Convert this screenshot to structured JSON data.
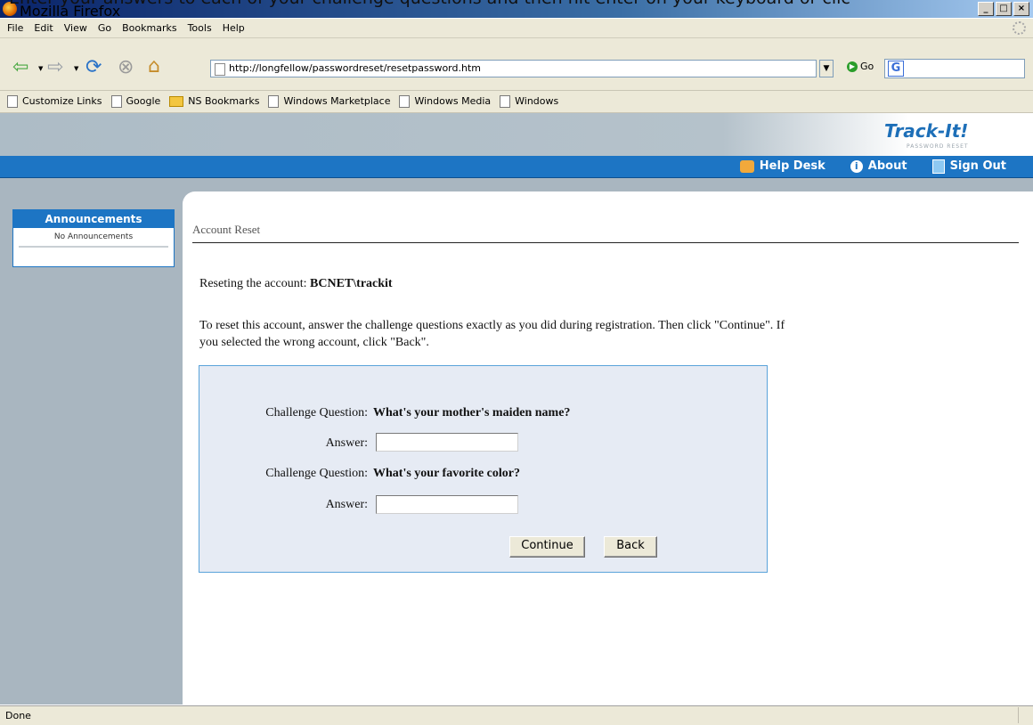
{
  "overlay_caption": "Enter your answers to each of your challenge questions and then hit enter on your keyboard or clic",
  "window": {
    "title": "Mozilla Firefox",
    "minimize": "_",
    "maximize": "□",
    "close": "×"
  },
  "menu": [
    "File",
    "Edit",
    "View",
    "Go",
    "Bookmarks",
    "Tools",
    "Help"
  ],
  "toolbar": {
    "url": "http://longfellow/passwordreset/resetpassword.htm",
    "go_label": "Go",
    "search_engine_glyph": "G"
  },
  "bookmarks": [
    {
      "label": "Customize Links",
      "type": "page"
    },
    {
      "label": "Google",
      "type": "page"
    },
    {
      "label": "NS Bookmarks",
      "type": "folder"
    },
    {
      "label": "Windows Marketplace",
      "type": "page"
    },
    {
      "label": "Windows Media",
      "type": "page"
    },
    {
      "label": "Windows",
      "type": "page"
    }
  ],
  "brand": {
    "logo": "Track-It!",
    "subtitle": "PASSWORD RESET"
  },
  "nav": {
    "help_desk": "Help Desk",
    "about": "About",
    "sign_out": "Sign Out"
  },
  "sidebar": {
    "title": "Announcements",
    "body": "No Announcements"
  },
  "page": {
    "title": "Account Reset",
    "reset_prefix": "Reseting the account: ",
    "account": "BCNET\\trackit",
    "instructions": "To reset this account, answer the challenge questions exactly as you did during registration. Then click \"Continue\". If you selected the wrong account, click \"Back\"."
  },
  "form": {
    "question_label": "Challenge Question:",
    "answer_label": "Answer:",
    "questions": [
      {
        "question": "What's your mother's maiden name?",
        "answer": ""
      },
      {
        "question": "What's your favorite color?",
        "answer": ""
      }
    ],
    "continue_label": "Continue",
    "back_label": "Back"
  },
  "status": {
    "text": "Done"
  },
  "colors": {
    "nav_blue": "#1d75c4",
    "sidebar_bg": "#a9b6c0",
    "form_bg": "#e6ebf4"
  }
}
